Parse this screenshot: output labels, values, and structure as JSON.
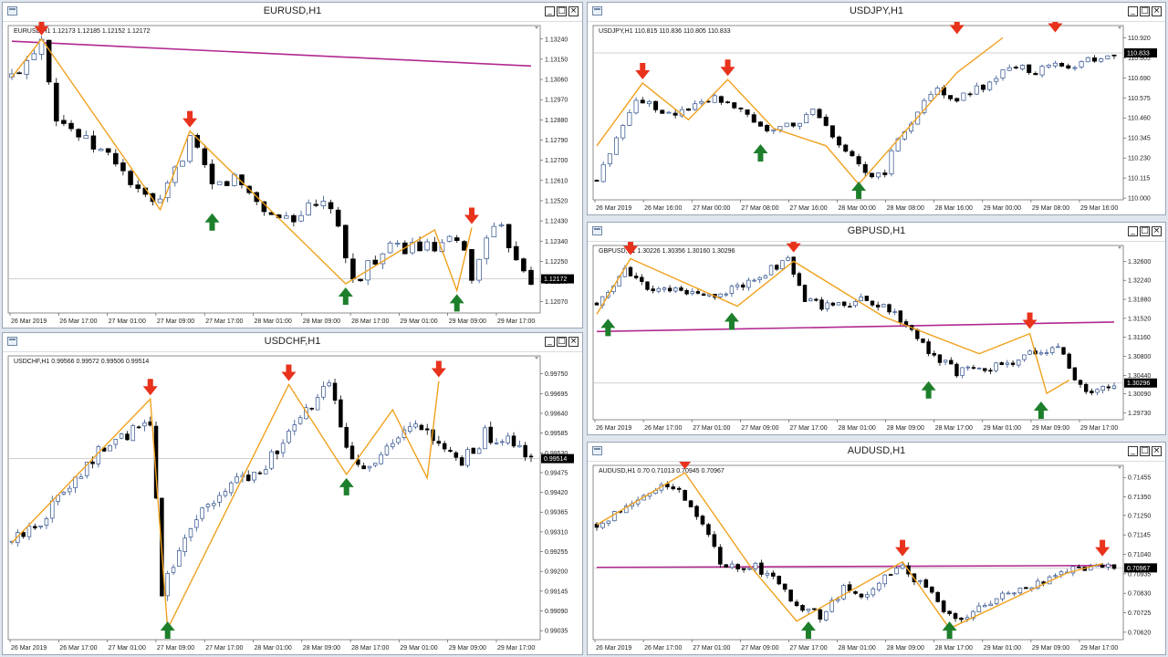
{
  "colors": {
    "bull": "#2e4f8c",
    "bear": "#000000",
    "zigzag": "#f0a11d",
    "ma": "#b2288f",
    "sell": "#e8321c",
    "buy": "#1d7f2b",
    "priceLine": "#c0c0c0"
  },
  "icons": {
    "sell": "red-down-arrow-icon",
    "buy": "green-up-arrow-icon",
    "window": "chart-window-icon"
  },
  "buttons": {
    "minimize": "_",
    "restore": "□",
    "close": "×"
  },
  "charts": [
    {
      "id": "eurusd",
      "title": "EURUSD,H1",
      "header": "EURUSD,H1  1.12173 1.12185 1.12152 1.12172",
      "current": "1.12172",
      "price_ticks": [
        "1.13240",
        "1.13150",
        "1.13060",
        "1.12970",
        "1.12880",
        "1.12790",
        "1.12700",
        "1.12610",
        "1.12520",
        "1.12430",
        "1.12340",
        "1.12250",
        "1.12160",
        "1.12070"
      ],
      "time_ticks": [
        "26 Mar 2019",
        "26 Mar 17:00",
        "27 Mar 01:00",
        "27 Mar 09:00",
        "27 Mar 17:00",
        "28 Mar 01:00",
        "28 Mar 09:00",
        "28 Mar 17:00",
        "29 Mar 01:00",
        "29 Mar 09:00",
        "29 Mar 17:00"
      ],
      "chart_data": {
        "type": "candlestick",
        "title": "EURUSD,H1",
        "ylim": [
          1.1202,
          1.133
        ],
        "close_path": [
          [
            0,
            1.1307
          ],
          [
            2,
            1.1315
          ],
          [
            4,
            1.1325
          ],
          [
            6,
            1.129
          ],
          [
            10,
            1.1278
          ],
          [
            14,
            1.127
          ],
          [
            17,
            1.1255
          ],
          [
            20,
            1.125
          ],
          [
            22,
            1.1265
          ],
          [
            24,
            1.128
          ],
          [
            27,
            1.1258
          ],
          [
            30,
            1.1262
          ],
          [
            33,
            1.1252
          ],
          [
            35,
            1.1245
          ],
          [
            38,
            1.1245
          ],
          [
            40,
            1.1248
          ],
          [
            43,
            1.125
          ],
          [
            45,
            1.1225
          ],
          [
            47,
            1.1215
          ],
          [
            48,
            1.1225
          ],
          [
            51,
            1.123
          ],
          [
            54,
            1.1232
          ],
          [
            57,
            1.123
          ],
          [
            59,
            1.1233
          ],
          [
            61,
            1.1232
          ],
          [
            62,
            1.1215
          ],
          [
            64,
            1.1238
          ],
          [
            66,
            1.1238
          ],
          [
            68,
            1.1228
          ],
          [
            70,
            1.1217
          ]
        ],
        "ma": [
          [
            0,
            1.1323
          ],
          [
            70,
            1.1312
          ]
        ],
        "zigzag": [
          [
            0,
            1.1307
          ],
          [
            4,
            1.1324
          ],
          [
            20,
            1.1248
          ],
          [
            24,
            1.1283
          ],
          [
            45,
            1.1215
          ],
          [
            57,
            1.1239
          ],
          [
            60,
            1.1212
          ],
          [
            62,
            1.124
          ]
        ],
        "sell_arrows": [
          [
            4,
            1.1324
          ],
          [
            24,
            1.1283
          ],
          [
            62,
            1.124
          ]
        ],
        "buy_arrows": [
          [
            27,
            1.1248
          ],
          [
            45,
            1.1215
          ],
          [
            60,
            1.1212
          ]
        ]
      }
    },
    {
      "id": "usdchf",
      "title": "USDCHF,H1",
      "header": "USDCHF,H1  0.99566 0.99572 0.99506 0.99514",
      "current": "0.99514",
      "price_ticks": [
        "0.99750",
        "0.99695",
        "0.99640",
        "0.99585",
        "0.99530",
        "0.99475",
        "0.99420",
        "0.99365",
        "0.99310",
        "0.99255",
        "0.99200",
        "0.99145",
        "0.99090",
        "0.99035"
      ],
      "time_ticks": [
        "26 Mar 2019",
        "26 Mar 17:00",
        "27 Mar 01:00",
        "27 Mar 09:00",
        "27 Mar 17:00",
        "28 Mar 01:00",
        "28 Mar 09:00",
        "28 Mar 17:00",
        "29 Mar 01:00",
        "29 Mar 09:00",
        "29 Mar 17:00"
      ],
      "chart_data": {
        "type": "candlestick",
        "title": "USDCHF,H1",
        "ylim": [
          0.9901,
          0.998
        ],
        "close_path": [
          [
            0,
            0.9928
          ],
          [
            5,
            0.9934
          ],
          [
            10,
            0.9945
          ],
          [
            15,
            0.9953
          ],
          [
            20,
            0.9958
          ],
          [
            24,
            0.9961
          ],
          [
            25,
            0.994
          ],
          [
            26,
            0.9915
          ],
          [
            28,
            0.9922
          ],
          [
            32,
            0.9936
          ],
          [
            38,
            0.9944
          ],
          [
            44,
            0.995
          ],
          [
            48,
            0.9958
          ],
          [
            52,
            0.9966
          ],
          [
            55,
            0.9972
          ],
          [
            58,
            0.9955
          ],
          [
            62,
            0.9948
          ],
          [
            66,
            0.9955
          ],
          [
            70,
            0.996
          ],
          [
            74,
            0.9955
          ],
          [
            78,
            0.995
          ],
          [
            82,
            0.9958
          ],
          [
            86,
            0.9956
          ],
          [
            90,
            0.9951
          ]
        ],
        "zigzag": [
          [
            0,
            0.9928
          ],
          [
            24,
            0.9968
          ],
          [
            27,
            0.9904
          ],
          [
            48,
            0.9972
          ],
          [
            58,
            0.9947
          ],
          [
            66,
            0.9965
          ],
          [
            72,
            0.9946
          ],
          [
            74,
            0.9973
          ]
        ],
        "sell_arrows": [
          [
            24,
            0.9968
          ],
          [
            48,
            0.9972
          ],
          [
            74,
            0.9973
          ]
        ],
        "buy_arrows": [
          [
            27,
            0.9904
          ],
          [
            58,
            0.9947
          ]
        ]
      }
    },
    {
      "id": "usdjpy",
      "title": "USDJPY,H1",
      "header": "USDJPY,H1  110.815 110.836 110.805 110.833",
      "current": "110.833",
      "price_ticks": [
        "110.920",
        "110.805",
        "110.690",
        "110.575",
        "110.460",
        "110.345",
        "110.230",
        "110.115",
        "110.000"
      ],
      "time_ticks": [
        "26 Mar 2019",
        "26 Mar 16:00",
        "27 Mar 00:00",
        "27 Mar 08:00",
        "27 Mar 16:00",
        "28 Mar 00:00",
        "28 Mar 08:00",
        "28 Mar 16:00",
        "29 Mar 00:00",
        "29 Mar 08:00",
        "29 Mar 16:00"
      ],
      "chart_data": {
        "type": "candlestick",
        "title": "USDJPY,H1",
        "ylim": [
          109.99,
          110.99
        ],
        "close_path": [
          [
            0,
            110.1
          ],
          [
            3,
            110.35
          ],
          [
            6,
            110.58
          ],
          [
            9,
            110.52
          ],
          [
            12,
            110.48
          ],
          [
            15,
            110.55
          ],
          [
            18,
            110.58
          ],
          [
            21,
            110.54
          ],
          [
            24,
            110.45
          ],
          [
            27,
            110.38
          ],
          [
            30,
            110.42
          ],
          [
            33,
            110.5
          ],
          [
            36,
            110.35
          ],
          [
            39,
            110.25
          ],
          [
            42,
            110.1
          ],
          [
            44,
            110.15
          ],
          [
            46,
            110.35
          ],
          [
            49,
            110.5
          ],
          [
            52,
            110.62
          ],
          [
            55,
            110.58
          ],
          [
            58,
            110.62
          ],
          [
            61,
            110.7
          ],
          [
            64,
            110.75
          ],
          [
            67,
            110.72
          ],
          [
            70,
            110.78
          ],
          [
            73,
            110.75
          ],
          [
            76,
            110.8
          ],
          [
            79,
            110.83
          ]
        ],
        "zigzag": [
          [
            0,
            110.3
          ],
          [
            7,
            110.66
          ],
          [
            14,
            110.45
          ],
          [
            20,
            110.68
          ],
          [
            27,
            110.4
          ],
          [
            35,
            110.3
          ],
          [
            40,
            110.08
          ],
          [
            55,
            110.72
          ],
          [
            62,
            110.92
          ]
        ],
        "sell_arrows": [
          [
            7,
            110.66
          ],
          [
            20,
            110.68
          ],
          [
            55,
            110.92
          ],
          [
            70,
            110.93
          ]
        ],
        "buy_arrows": [
          [
            25,
            110.33
          ],
          [
            40,
            110.07
          ]
        ]
      }
    },
    {
      "id": "gbpusd",
      "title": "GBPUSD,H1",
      "header": "GBPUSD,H1  1.30226 1.30356 1.30160 1.30296",
      "current": "1.30296",
      "price_ticks": [
        "1.32600",
        "1.32240",
        "1.31880",
        "1.31520",
        "1.31160",
        "1.30800",
        "1.30440",
        "1.30090",
        "1.29730"
      ],
      "time_ticks": [
        "26 Mar 2019",
        "26 Mar 17:00",
        "27 Mar 01:00",
        "27 Mar 09:00",
        "27 Mar 17:00",
        "28 Mar 01:00",
        "28 Mar 09:00",
        "28 Mar 17:00",
        "29 Mar 01:00",
        "29 Mar 09:00",
        "29 Mar 17:00"
      ],
      "chart_data": {
        "type": "candlestick",
        "title": "GBPUSD,H1",
        "ylim": [
          1.296,
          1.329
        ],
        "close_path": [
          [
            0,
            1.318
          ],
          [
            3,
            1.322
          ],
          [
            5,
            1.325
          ],
          [
            8,
            1.3215
          ],
          [
            12,
            1.3205
          ],
          [
            16,
            1.32
          ],
          [
            20,
            1.3195
          ],
          [
            24,
            1.3205
          ],
          [
            28,
            1.3225
          ],
          [
            31,
            1.3245
          ],
          [
            34,
            1.326
          ],
          [
            37,
            1.319
          ],
          [
            40,
            1.3175
          ],
          [
            44,
            1.318
          ],
          [
            48,
            1.319
          ],
          [
            52,
            1.317
          ],
          [
            56,
            1.313
          ],
          [
            60,
            1.308
          ],
          [
            64,
            1.305
          ],
          [
            68,
            1.3055
          ],
          [
            72,
            1.3065
          ],
          [
            76,
            1.308
          ],
          [
            80,
            1.309
          ],
          [
            82,
            1.31
          ],
          [
            84,
            1.306
          ],
          [
            86,
            1.302
          ],
          [
            88,
            1.301
          ],
          [
            90,
            1.3025
          ],
          [
            92,
            1.303
          ]
        ],
        "ma": [
          [
            0,
            1.3127
          ],
          [
            92,
            1.3145
          ]
        ],
        "zigzag": [
          [
            0,
            1.316
          ],
          [
            6,
            1.3265
          ],
          [
            25,
            1.3175
          ],
          [
            35,
            1.326
          ],
          [
            51,
            1.3155
          ],
          [
            68,
            1.3085
          ],
          [
            77,
            1.3123
          ],
          [
            80,
            1.301
          ],
          [
            84,
            1.3035
          ]
        ],
        "sell_arrows": [
          [
            6,
            1.3265
          ],
          [
            35,
            1.327
          ],
          [
            77,
            1.3125
          ]
        ],
        "buy_arrows": [
          [
            2,
            1.3158
          ],
          [
            24,
            1.317
          ],
          [
            59,
            1.304
          ],
          [
            79,
            1.299
          ]
        ]
      }
    },
    {
      "id": "audusd",
      "title": "AUDUSD,H1",
      "header": "AUDUSD,H1  0.70    0.71013 0.70945 0.70967",
      "current": "0.70967",
      "price_ticks": [
        "0.71455",
        "0.71350",
        "0.71250",
        "0.71145",
        "0.71040",
        "0.70935",
        "0.70830",
        "0.70725",
        "0.70620"
      ],
      "time_ticks": [
        "26 Mar 2019",
        "26 Mar 17:00",
        "27 Mar 01:00",
        "27 Mar 09:00",
        "27 Mar 17:00",
        "28 Mar 01:00",
        "28 Mar 09:00",
        "28 Mar 17:00",
        "29 Mar 01:00",
        "29 Mar 09:00",
        "29 Mar 17:00"
      ],
      "chart_data": {
        "type": "candlestick",
        "title": "AUDUSD,H1",
        "ylim": [
          0.7058,
          0.7152
        ],
        "close_path": [
          [
            0,
            0.712
          ],
          [
            4,
            0.7128
          ],
          [
            8,
            0.7138
          ],
          [
            12,
            0.7142
          ],
          [
            15,
            0.7135
          ],
          [
            18,
            0.712
          ],
          [
            21,
            0.71
          ],
          [
            24,
            0.7095
          ],
          [
            27,
            0.7098
          ],
          [
            30,
            0.709
          ],
          [
            34,
            0.7078
          ],
          [
            38,
            0.707
          ],
          [
            42,
            0.7085
          ],
          [
            46,
            0.7082
          ],
          [
            49,
            0.7092
          ],
          [
            52,
            0.7098
          ],
          [
            54,
            0.709
          ],
          [
            57,
            0.7085
          ],
          [
            60,
            0.707
          ],
          [
            64,
            0.7072
          ],
          [
            68,
            0.708
          ],
          [
            72,
            0.7085
          ],
          [
            76,
            0.709
          ],
          [
            80,
            0.7095
          ],
          [
            84,
            0.7098
          ],
          [
            88,
            0.7097
          ]
        ],
        "ma": [
          [
            0,
            0.7097
          ],
          [
            88,
            0.7098
          ]
        ],
        "zigzag": [
          [
            0,
            0.712
          ],
          [
            15,
            0.7148
          ],
          [
            26,
            0.7098
          ],
          [
            34,
            0.7068
          ],
          [
            52,
            0.71
          ],
          [
            60,
            0.7064
          ],
          [
            80,
            0.7094
          ],
          [
            86,
            0.7099
          ]
        ],
        "sell_arrows": [
          [
            15,
            0.7148
          ],
          [
            52,
            0.7101
          ],
          [
            86,
            0.7101
          ]
        ],
        "buy_arrows": [
          [
            36,
            0.7066
          ],
          [
            60,
            0.7062
          ]
        ]
      }
    }
  ]
}
